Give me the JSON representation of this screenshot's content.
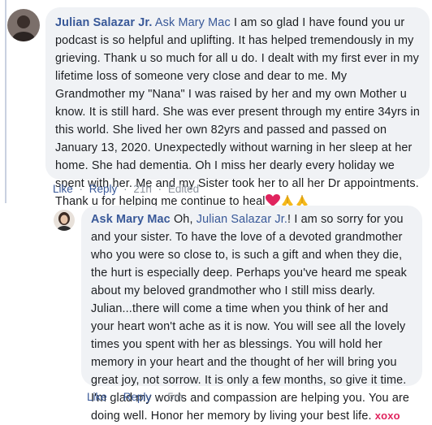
{
  "comment": {
    "author": "Julian Salazar Jr.",
    "mention": "Ask Mary Mac",
    "text": "I am so glad I have found you ur podcast is so helpful and uplifting. It has helped tremendously in my grieving. Thank u so much for all u do. I dealt with my first ever in my lifetime loss of someone very close and dear to me. My Grandmother my \"Nana\" I was raised by her and my own Mother u know. It is still hard. She was ever present through my entire 34yrs in this world. She lived her own 82yrs and passed and passed on January 13, 2020. Unexpectedly without warning in her sleep at her home. She had dementia. Oh I miss her dearly every holiday we spent with her. Me and my Sister took her to all her Dr appointments. Thank u for helping me continue to heal",
    "emojis": [
      "red-heart",
      "folded-hands",
      "folded-hands"
    ],
    "actions": {
      "like": "Like",
      "reply": "Reply",
      "time": "21h",
      "edited": "Edited"
    }
  },
  "reply": {
    "author": "Ask Mary Mac",
    "text_before": "Oh,",
    "mention": "Julian Salazar Jr.",
    "text_after": "! I am so sorry for you and your sister. To have the love of a devoted grandmother who you were so close to, is such a gift and when they die, the hurt is especially deep. Perhaps you've heard me speak about my beloved grandmother who I still miss dearly. Julian...there will come a time when you think of her and your heart won't ache as it is now. You will see all the lovely times you spent with her as blessings. You will hold her memory in your heart and the thought of her will bring you great joy, not sorrow. It is only a few months, so give it time. I'm glad my words and compassion are helping you. You are doing well. Honor her memory by living your best life.",
    "signoff": "xoxo",
    "actions": {
      "like": "Like",
      "reply": "Reply",
      "time": "5m"
    }
  },
  "colors": {
    "link": "#385898",
    "bubble": "#f0f2f5",
    "meta": "#8d949e",
    "accent_xoxo": "#e0245e"
  }
}
